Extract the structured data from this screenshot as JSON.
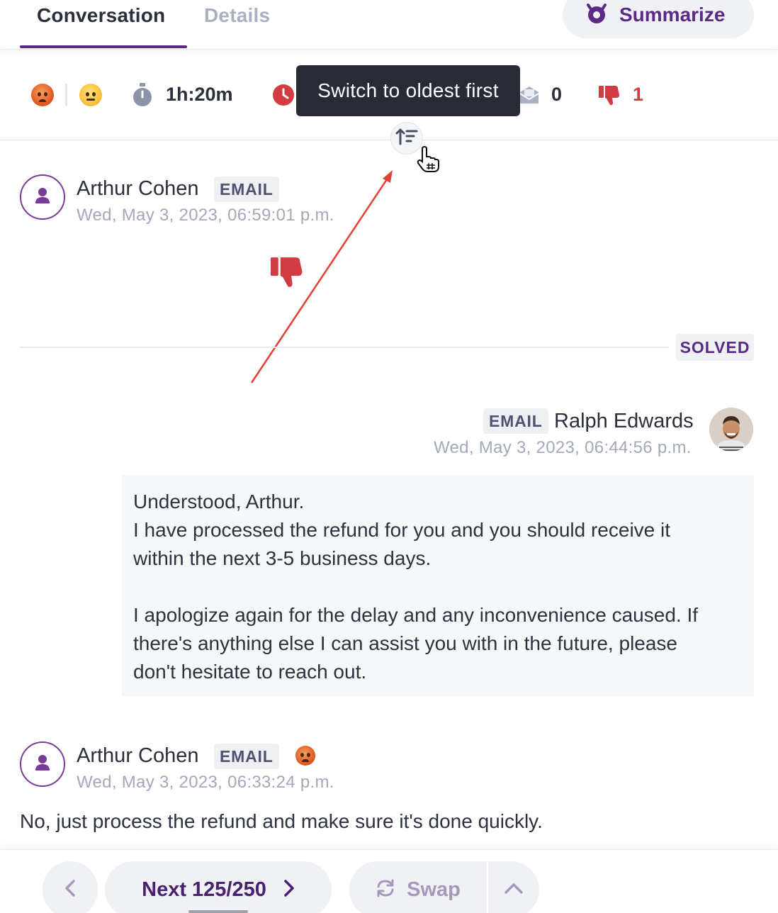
{
  "tabs": [
    {
      "label": "Conversation",
      "active": true
    },
    {
      "label": "Details",
      "active": false
    }
  ],
  "summarize_label": "Summarize",
  "stats": {
    "sentiment_start": "angry-face-emoji",
    "sentiment_end": "neutral-face-emoji",
    "handle_time": "1h:20m",
    "email_count": "0",
    "negative_count": "1"
  },
  "tooltip": "Switch to oldest first",
  "messages": [
    {
      "author": "Arthur Cohen",
      "channel": "EMAIL",
      "timestamp": "Wed, May 3, 2023, 06:59:01 p.m.",
      "content_icon": "thumbs-down-icon"
    },
    {
      "author": "Ralph Edwards",
      "channel": "EMAIL",
      "timestamp": "Wed, May 3, 2023, 06:44:56 p.m.",
      "body": [
        "Understood, Arthur.",
        "I have processed the refund for you and you should receive it",
        "within the next 3-5 business days.",
        "",
        "I apologize again for the delay and any inconvenience caused. If",
        "there's anything else I can assist you with in the future, please",
        "don't hesitate to reach out."
      ]
    },
    {
      "author": "Arthur Cohen",
      "channel": "EMAIL",
      "timestamp": "Wed, May 3, 2023, 06:33:24 p.m.",
      "body": "No, just process the refund and make sure it's done quickly."
    }
  ],
  "status_badge": "SOLVED",
  "footer": {
    "next_label": "Next 125/250",
    "swap_label": "Swap"
  },
  "colors": {
    "accent": "#5a2a86",
    "negative": "#d13c43",
    "muted": "#a3a9ba"
  }
}
